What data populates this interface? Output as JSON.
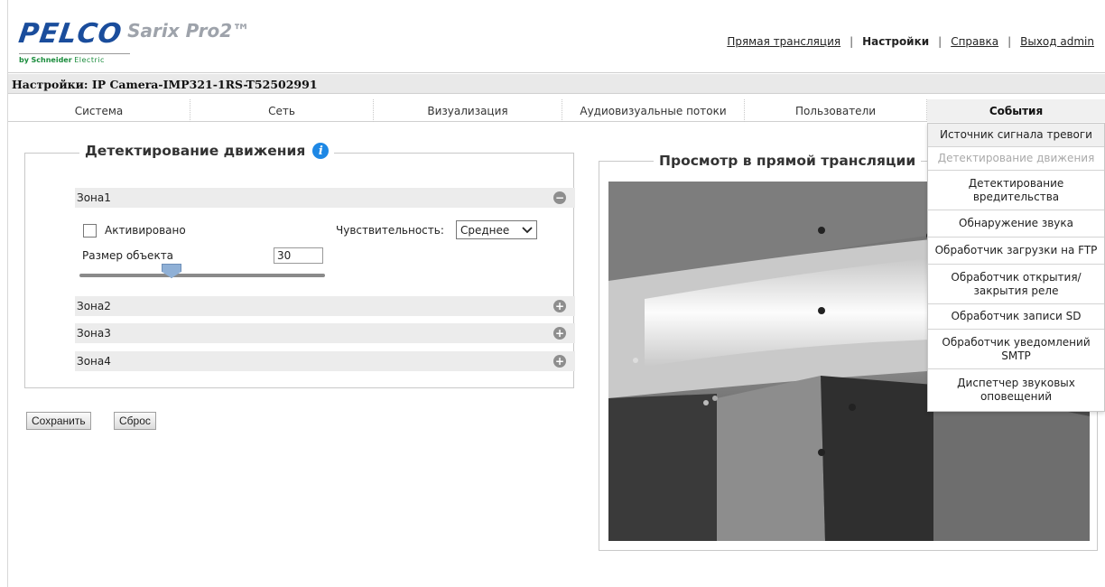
{
  "header": {
    "logo_brand": "PELCO",
    "logo_product": "Sarix Pro2™",
    "logo_by": "by",
    "logo_company": "Schneider",
    "logo_company_sub": "Electric",
    "nav": {
      "live": "Прямая трансляция",
      "settings": "Настройки",
      "help": "Справка",
      "logout": "Выход admin"
    }
  },
  "title": "Настройки: IP Camera-IMP321-1RS-T52502991",
  "tabs": [
    "Система",
    "Сеть",
    "Визуализация",
    "Аудиовизуальные потоки",
    "Пользователи",
    "События"
  ],
  "active_tab": "События",
  "motion": {
    "heading": "Детектирование движения",
    "zones": [
      "Зона1",
      "Зона2",
      "Зона3",
      "Зона4"
    ],
    "zone1": {
      "enabled_label": "Активировано",
      "enabled": false,
      "sensitivity_label": "Чувствительность:",
      "sensitivity_value": "Среднее",
      "object_size_label": "Размер объекта",
      "object_size_value": "30"
    }
  },
  "buttons": {
    "save": "Сохранить",
    "reset": "Сброс"
  },
  "live_view": {
    "heading": "Просмотр в прямой трансляции"
  },
  "events_menu": [
    {
      "label": "Источник сигнала тревоги",
      "state": "current"
    },
    {
      "label": "Детектирование движения",
      "state": "disabled"
    },
    {
      "label": "Детектирование вредительства",
      "state": "normal"
    },
    {
      "label": "Обнаружение звука",
      "state": "normal"
    },
    {
      "label": "Обработчик загрузки на FTP",
      "state": "normal"
    },
    {
      "label": "Обработчик открытия/закрытия реле",
      "state": "normal"
    },
    {
      "label": "Обработчик записи SD",
      "state": "normal"
    },
    {
      "label": "Обработчик уведомлений SMTP",
      "state": "normal"
    },
    {
      "label": "Диспетчер звуковых оповещений",
      "state": "normal"
    }
  ],
  "colors": {
    "brand_blue": "#1a4d9c",
    "schneider_green": "#1a8c3c",
    "info_blue": "#1e88e5"
  }
}
